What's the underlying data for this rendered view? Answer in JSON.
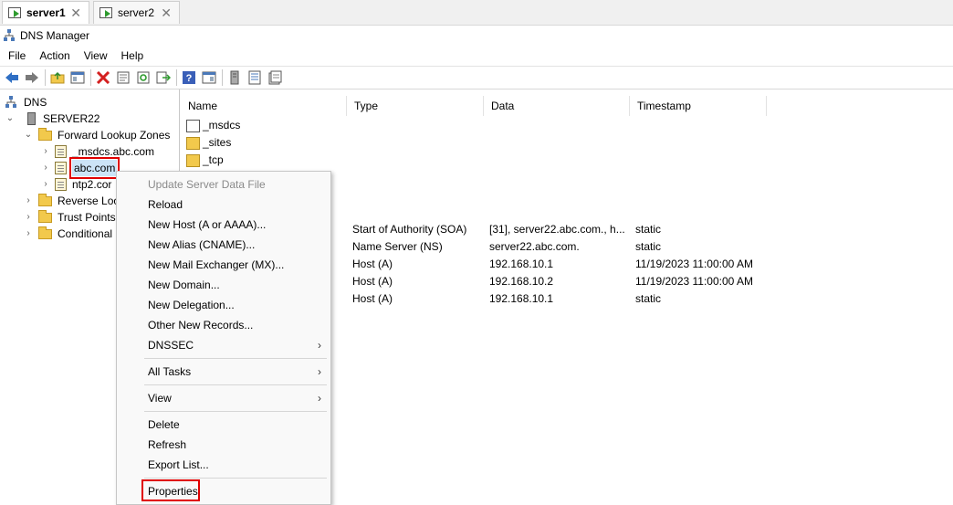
{
  "tabs": [
    {
      "label": "server1",
      "active": true
    },
    {
      "label": "server2",
      "active": false
    }
  ],
  "window": {
    "title": "DNS Manager"
  },
  "menu": [
    "File",
    "Action",
    "View",
    "Help"
  ],
  "toolbar": [
    "back-icon",
    "forward-icon",
    "up-folder-icon",
    "show-hide-tree-icon",
    "delete-icon",
    "properties-icon",
    "refresh-icon",
    "export-icon",
    "help-icon",
    "console-icon",
    "server-icon",
    "list-icon",
    "record-icon"
  ],
  "tree": {
    "root": "DNS",
    "server": "SERVER22",
    "forward_zones": "Forward Lookup Zones",
    "zone_msdcs": "_msdcs.abc.com",
    "zone_abc": "abc.com",
    "zone_ntp2": "ntp2.cor",
    "reverse_zones": "Reverse Loo",
    "trust_points": "Trust Points",
    "conditional": "Conditional"
  },
  "list": {
    "columns": [
      "Name",
      "Type",
      "Data",
      "Timestamp"
    ],
    "folders": [
      "_msdcs",
      "_sites",
      "_tcp"
    ],
    "records": [
      {
        "type": "Start of Authority (SOA)",
        "data": "[31], server22.abc.com., h...",
        "timestamp": "static"
      },
      {
        "type": "Name Server (NS)",
        "data": "server22.abc.com.",
        "timestamp": "static"
      },
      {
        "type": "Host (A)",
        "data": "192.168.10.1",
        "timestamp": "11/19/2023 11:00:00 AM"
      },
      {
        "type": "Host (A)",
        "data": "192.168.10.2",
        "timestamp": "11/19/2023 11:00:00 AM"
      },
      {
        "type": "Host (A)",
        "data": "192.168.10.1",
        "timestamp": "static"
      }
    ]
  },
  "context_menu": {
    "update_server_data_file": "Update Server Data File",
    "reload": "Reload",
    "new_host": "New Host (A or AAAA)...",
    "new_alias": "New Alias (CNAME)...",
    "new_mail_exchanger": "New Mail Exchanger (MX)...",
    "new_domain": "New Domain...",
    "new_delegation": "New Delegation...",
    "other_new_records": "Other New Records...",
    "dnssec": "DNSSEC",
    "all_tasks": "All Tasks",
    "view": "View",
    "delete": "Delete",
    "refresh": "Refresh",
    "export_list": "Export List...",
    "properties": "Properties"
  },
  "colors": {
    "highlight": "#e00000",
    "selection": "#cce4f7"
  }
}
